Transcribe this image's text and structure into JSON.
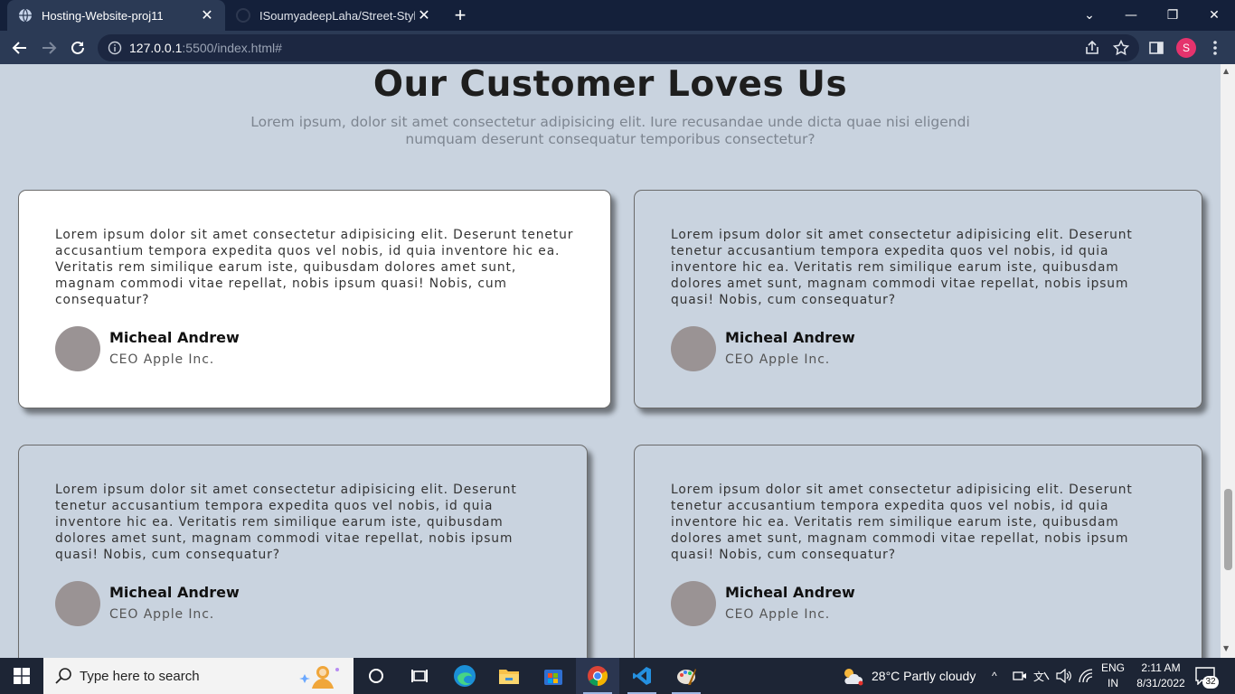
{
  "browser": {
    "tabs": [
      {
        "title": "Hosting-Website-proj11",
        "active": true
      },
      {
        "title": "ISoumyadeepLaha/Street-Style-L",
        "active": false
      }
    ],
    "url_host": "127.0.0.1",
    "url_rest": ":5500/index.html#",
    "profile_initial": "S"
  },
  "page": {
    "heading": "Our Customer Loves Us",
    "subtext": "Lorem ipsum, dolor sit amet consectetur adipisicing elit. Iure recusandae unde dicta quae nisi eligendi numquam deserunt consequatur temporibus consectetur?",
    "testimonials": [
      {
        "quote": "Lorem ipsum dolor sit amet consectetur adipisicing elit. Deserunt tenetur accusantium tempora expedita quos vel nobis, id quia inventore hic ea. Veritatis rem similique earum iste, quibusdam dolores amet sunt, magnam commodi vitae repellat, nobis ipsum quasi! Nobis, cum consequatur?",
        "name": "Micheal Andrew",
        "role": "CEO Apple Inc.",
        "highlighted": true
      },
      {
        "quote": "Lorem ipsum dolor sit amet consectetur adipisicing elit. Deserunt tenetur accusantium tempora expedita quos vel nobis, id quia inventore hic ea. Veritatis rem similique earum iste, quibusdam dolores amet sunt, magnam commodi vitae repellat, nobis ipsum quasi! Nobis, cum consequatur?",
        "name": "Micheal Andrew",
        "role": "CEO Apple Inc.",
        "highlighted": false
      },
      {
        "quote": "Lorem ipsum dolor sit amet consectetur adipisicing elit. Deserunt tenetur accusantium tempora expedita quos vel nobis, id quia inventore hic ea. Veritatis rem similique earum iste, quibusdam dolores amet sunt, magnam commodi vitae repellat, nobis ipsum quasi! Nobis, cum consequatur?",
        "name": "Micheal Andrew",
        "role": "CEO Apple Inc.",
        "highlighted": false
      },
      {
        "quote": "Lorem ipsum dolor sit amet consectetur adipisicing elit. Deserunt tenetur accusantium tempora expedita quos vel nobis, id quia inventore hic ea. Veritatis rem similique earum iste, quibusdam dolores amet sunt, magnam commodi vitae repellat, nobis ipsum quasi! Nobis, cum consequatur?",
        "name": "Micheal Andrew",
        "role": "CEO Apple Inc.",
        "highlighted": false
      }
    ]
  },
  "taskbar": {
    "search_placeholder": "Type here to search",
    "apps": [
      "cortana-icon",
      "task-view-icon",
      "edge-icon",
      "file-explorer-icon",
      "microsoft-store-icon",
      "chrome-icon",
      "vscode-icon",
      "paint-icon"
    ],
    "weather": "28°C  Partly cloudy",
    "lang_line1": "ENG",
    "lang_line2": "IN",
    "time": "2:11 AM",
    "date": "8/31/2022",
    "notification_count": "32"
  },
  "colors": {
    "page_bg": "#c9d3df",
    "card_highlight": "#ffffff",
    "avatar": "#9a9394",
    "tabstrip": "#14203a",
    "toolbar": "#2b3a55"
  }
}
